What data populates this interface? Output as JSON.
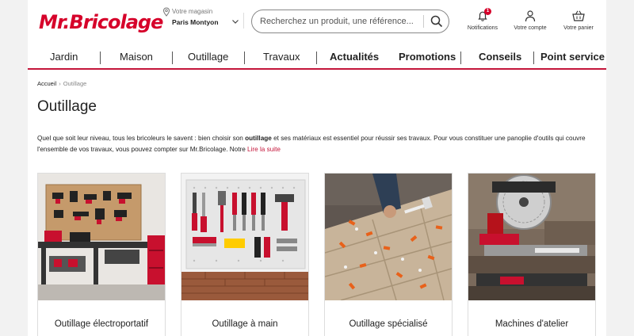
{
  "header": {
    "logo": "Mr.Bricolage",
    "store_label": "Votre magasin",
    "store_name": "Paris Montyon",
    "search_placeholder": "Recherchez un produit, une référence...",
    "notifications_label": "Notifications",
    "notifications_count": "1",
    "account_label": "Votre compte",
    "cart_label": "Votre panier"
  },
  "nav": {
    "items": [
      "Jardin",
      "Maison",
      "Outillage",
      "Travaux",
      "Actualités",
      "Promotions",
      "Conseils",
      "Point service"
    ]
  },
  "breadcrumb": {
    "home": "Accueil",
    "current": "Outillage"
  },
  "page": {
    "title": "Outillage",
    "desc_1": "Quel que soit leur niveau, tous les bricoleurs le savent : bien choisir son ",
    "desc_bold": "outillage",
    "desc_2": " et ses matériaux est essentiel pour réussir ses travaux. Pour vous constituer une panoplie d'outils qui couvre l'ensemble de vos travaux, vous pouvez compter sur Mr.Bricolage. Notre ",
    "read_more": "Lire la suite"
  },
  "categories": [
    {
      "label": "Outillage électroportatif"
    },
    {
      "label": "Outillage à main"
    },
    {
      "label": "Outillage spécialisé"
    },
    {
      "label": "Machines d'atelier"
    }
  ],
  "colors": {
    "brand": "#d6002a",
    "nav_border": "#c4153a",
    "link": "#c4153a"
  }
}
